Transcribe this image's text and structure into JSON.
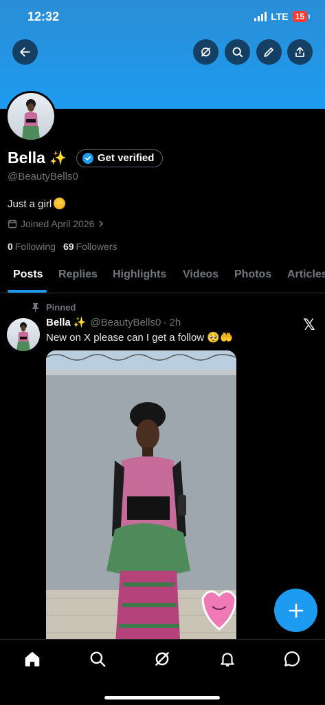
{
  "status_bar": {
    "time": "12:32",
    "network": "LTE",
    "battery": "15"
  },
  "header_actions": {
    "back_icon": "arrow-left-icon",
    "grok_icon": "grok-icon",
    "search_icon": "search-icon",
    "edit_icon": "pencil-icon",
    "share_icon": "share-icon"
  },
  "profile": {
    "name": "Bella",
    "name_emoji": "✨",
    "verify_label": "Get verified",
    "handle": "@BeautyBells0",
    "bio": "Just a girl",
    "joined": "Joined April 2026",
    "following_count": "0",
    "following_label": "Following",
    "followers_count": "69",
    "followers_label": "Followers"
  },
  "tabs": [
    "Posts",
    "Replies",
    "Highlights",
    "Videos",
    "Photos",
    "Articles"
  ],
  "active_tab": "Posts",
  "pinned_post": {
    "pinned_label": "Pinned",
    "author_name": "Bella",
    "author_emoji": "✨",
    "author_handle": "@BeautyBells0",
    "time": "· 2h",
    "text": "New on X please can I get a follow",
    "text_emojis": "🥺🤲"
  },
  "fab": {
    "icon": "plus-icon"
  },
  "bottom_nav": [
    "home-icon",
    "search-icon",
    "grok-icon",
    "notifications-icon",
    "messages-icon"
  ],
  "colors": {
    "accent": "#1d9bf0",
    "banner": "#1d9bf0",
    "background": "#000000",
    "muted": "#71767b"
  }
}
